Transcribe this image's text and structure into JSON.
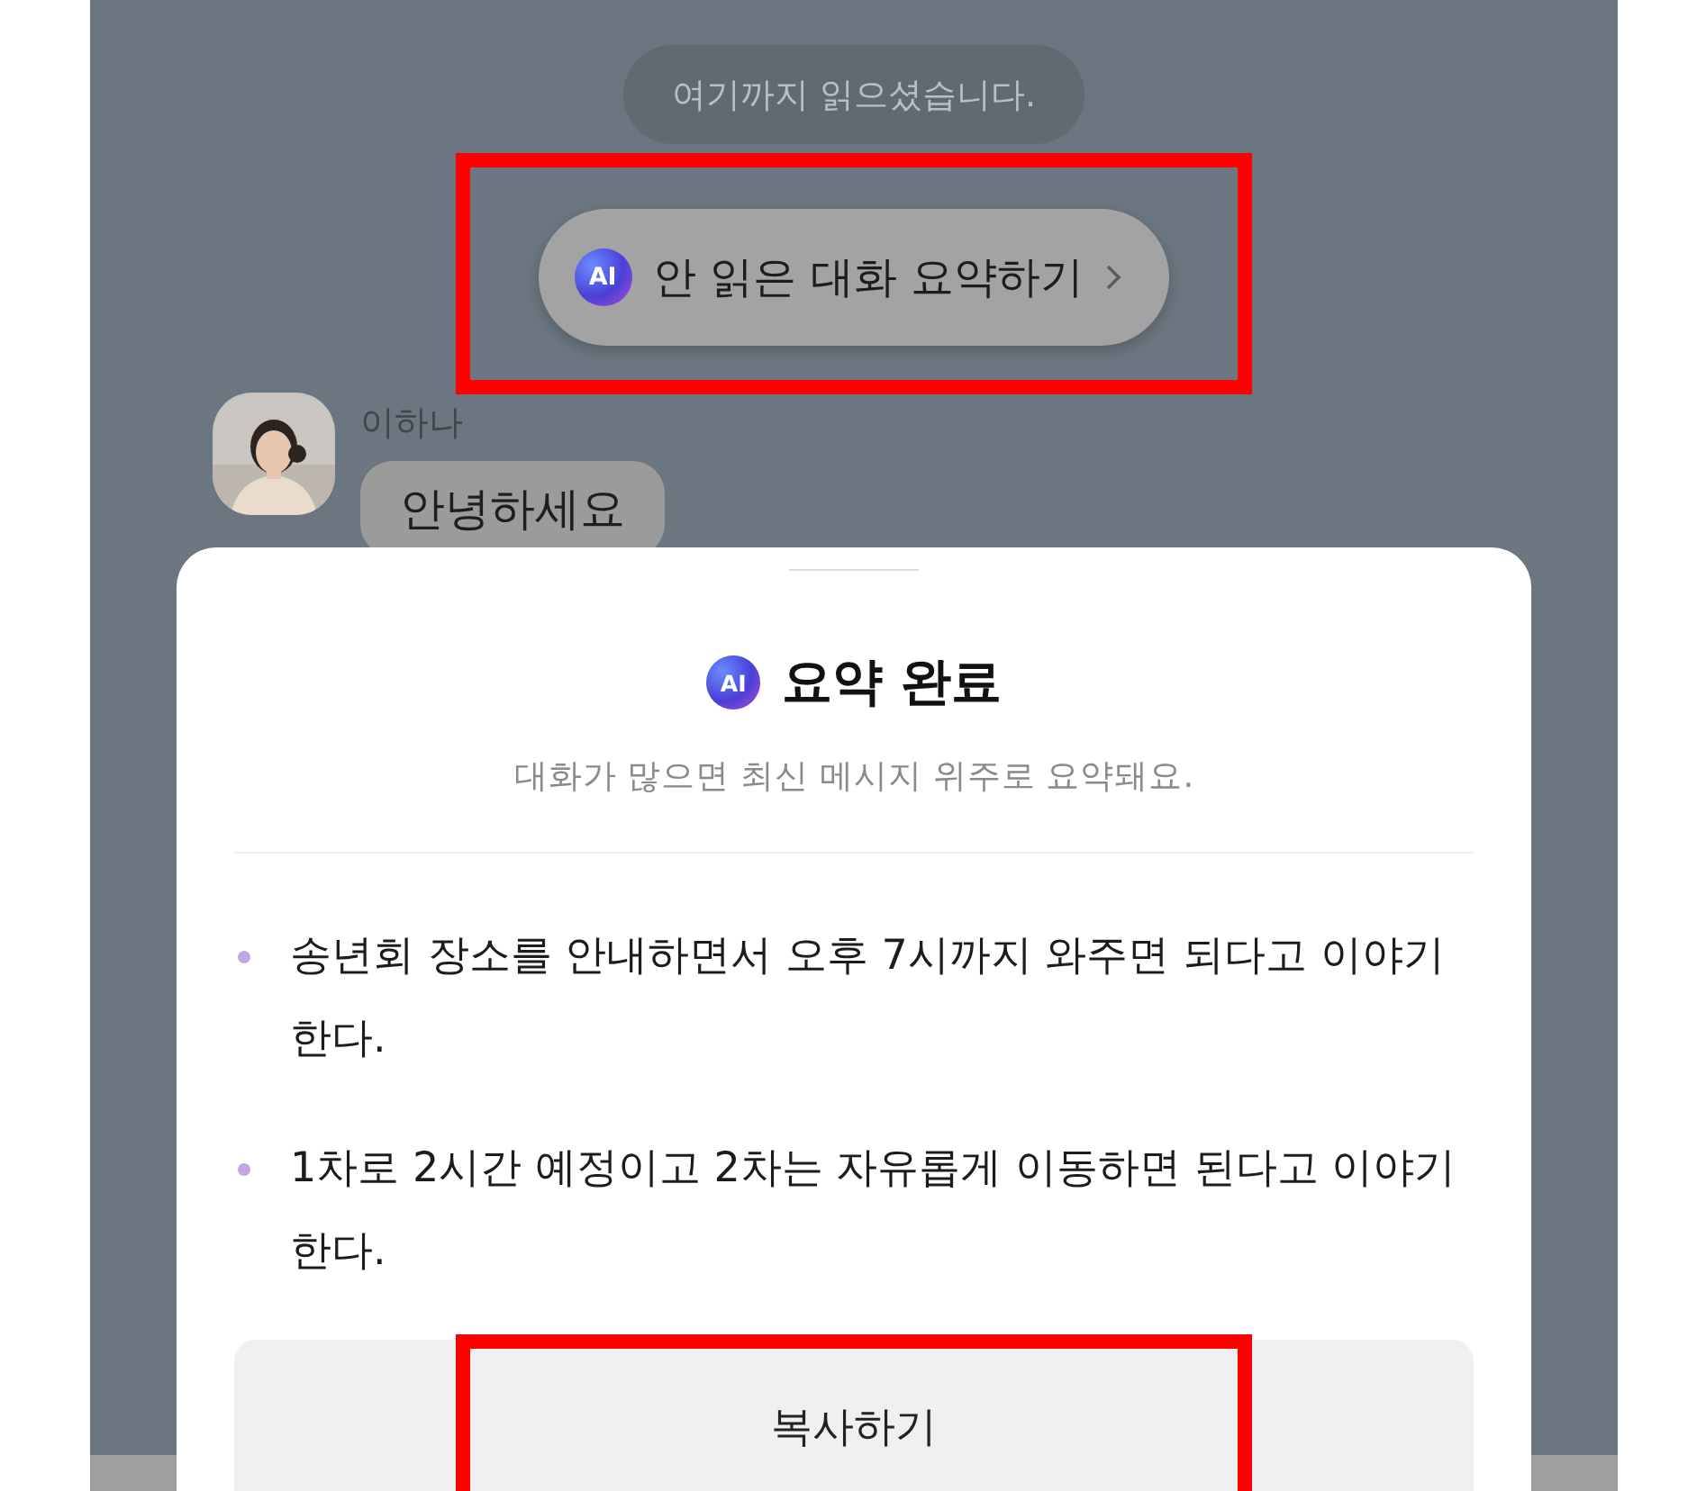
{
  "read_marker": "여기까지 읽으셨습니다.",
  "summary_pill": {
    "badge": "AI",
    "label": "안 읽은 대화 요약하기",
    "highlighted": true
  },
  "message": {
    "sender": "이하나",
    "text": "안녕하세요"
  },
  "sheet": {
    "badge": "AI",
    "title": "요약 완료",
    "subtitle": "대화가 많으면 최신 메시지 위주로 요약돼요.",
    "items": [
      "송년회 장소를 안내하면서 오후 7시까지 와주면 되다고 이야기한다.",
      "1차로 2시간 예정이고 2차는 자유롭게 이동하면 된다고 이야기한다."
    ],
    "copy_button": {
      "label": "복사하기",
      "highlighted": true
    }
  }
}
